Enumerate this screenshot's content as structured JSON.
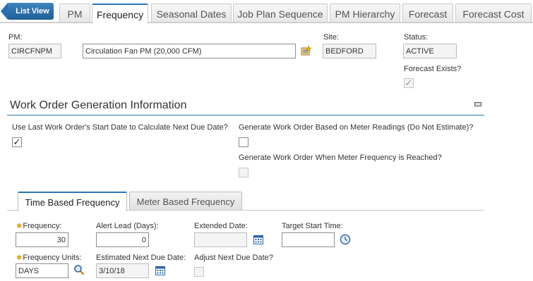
{
  "top_tabs": {
    "list_view": "List View",
    "tabs": [
      "PM",
      "Frequency",
      "Seasonal Dates",
      "Job Plan Sequence",
      "PM Hierarchy",
      "Forecast",
      "Forecast Cost"
    ]
  },
  "header": {
    "pm_label": "PM:",
    "pm_value": "CIRCFNPM",
    "description": "Circulation Fan PM (20,000 CFM)",
    "site_label": "Site:",
    "site_value": "BEDFORD",
    "status_label": "Status:",
    "status_value": "ACTIVE",
    "forecast_exists_label": "Forecast Exists?",
    "forecast_exists_checked": true
  },
  "section": {
    "title": "Work Order Generation Information",
    "use_last_label": "Use Last Work Order's Start Date to Calculate Next Due Date?",
    "use_last_checked": true,
    "meter_readings_label": "Generate Work Order Based on Meter Readings (Do Not Estimate)?",
    "meter_readings_checked": false,
    "meter_freq_label": "Generate Work Order When Meter Frequency is Reached?",
    "meter_freq_checked": false
  },
  "inner_tabs": [
    "Time Based Frequency",
    "Meter Based Frequency"
  ],
  "time_based": {
    "frequency_label": "Frequency:",
    "frequency_value": "30",
    "alert_lead_label": "Alert Lead (Days):",
    "alert_lead_value": "0",
    "extended_date_label": "Extended Date:",
    "extended_date_value": "",
    "target_start_label": "Target Start Time:",
    "target_start_value": "",
    "frequency_units_label": "Frequency Units:",
    "frequency_units_value": "DAYS",
    "est_next_due_label": "Estimated Next Due Date:",
    "est_next_due_value": "3/10/18",
    "adjust_next_due_label": "Adjust Next Due Date?",
    "adjust_next_due_checked": false
  },
  "icons": {
    "detail_menu": "detail-menu-icon",
    "calendar": "calendar-icon",
    "clock": "clock-icon",
    "lookup": "magnifier-icon",
    "minimize": "minimize-icon"
  },
  "colors": {
    "accent": "#2b74b6",
    "required": "#e8a100"
  }
}
